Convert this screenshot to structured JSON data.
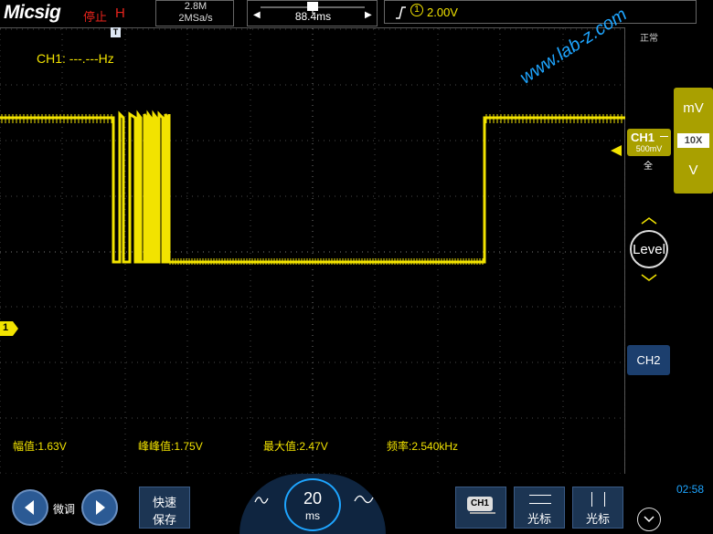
{
  "header": {
    "logo": "Micsig",
    "run_state": "停止",
    "mode": "H",
    "memory_depth": "2.8M",
    "sample_rate": "2MSa/s",
    "time_position": "88.4ms",
    "trigger_level": "2.00V",
    "trigger_source_badge": "1",
    "trigger_marker": "T"
  },
  "screen": {
    "frequency_readout": "CH1: ---.---Hz",
    "channel_marker": "1",
    "watermark": "www.lab-z.com",
    "measurements": [
      "幅值:1.63V",
      "峰峰值:1.75V",
      "最大值:2.47V",
      "频率:2.540kHz"
    ],
    "waveform_color": "#f2e300"
  },
  "right_panel": {
    "trigger_mode": "正常",
    "unit_mv": "mV",
    "probe_ratio": "10X",
    "unit_v": "V",
    "ch1_name": "CH1",
    "ch1_scale": "500mV",
    "ch1_coupling": "全",
    "level_label": "Level",
    "ch2_label": "CH2",
    "clock": "02:58"
  },
  "bottom": {
    "fine_label": "微调",
    "quick_save_line1": "快速",
    "quick_save_line2": "保存",
    "timebase_value": "20",
    "timebase_unit": "ms",
    "ch1_chip": "CH1",
    "cursor1_label": "光标",
    "cursor2_label": "光标"
  },
  "colors": {
    "accent_blue": "#1ea5ff",
    "channel_yellow": "#f2e300",
    "stop_red": "#e8231c"
  }
}
